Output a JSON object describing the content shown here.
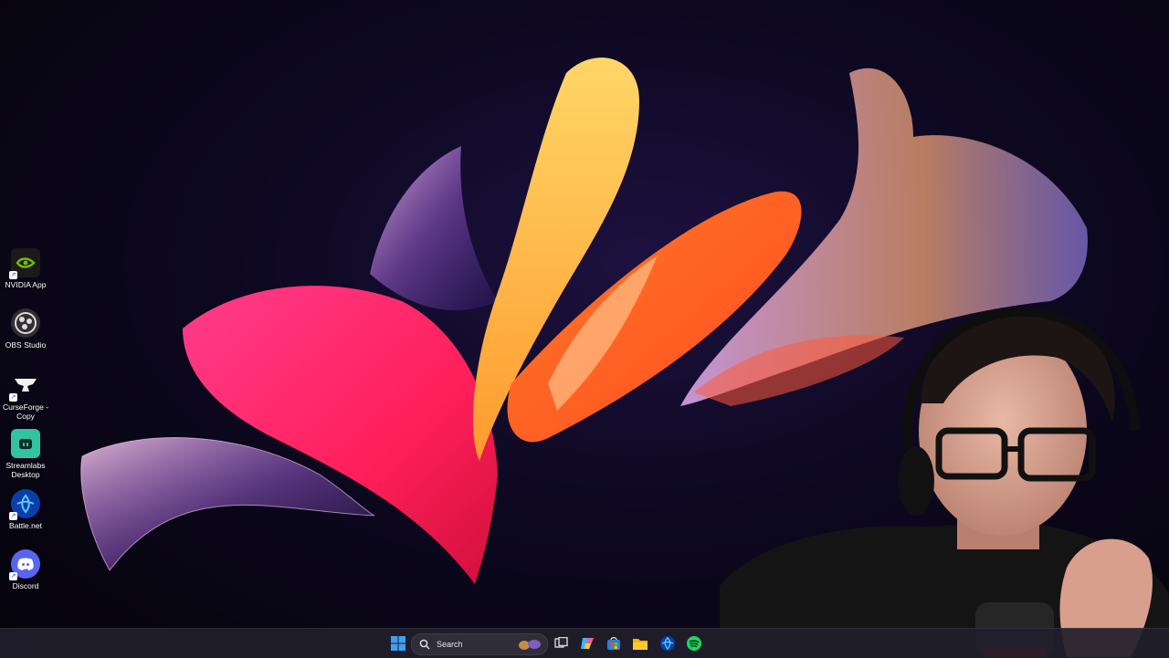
{
  "desktop": {
    "icons": [
      {
        "label": "NVIDIA App",
        "icon": "nvidia-icon",
        "color": "#76b900"
      },
      {
        "label": "OBS Studio",
        "icon": "obs-icon",
        "color": "#302e31"
      },
      {
        "label": "CurseForge - Copy",
        "icon": "curseforge-icon",
        "color": "#1b1b1b"
      },
      {
        "label": "Streamlabs Desktop",
        "icon": "streamlabs-icon",
        "color": "#31c3a2"
      },
      {
        "label": "Battle.net",
        "icon": "battlenet-icon",
        "color": "#148eff"
      },
      {
        "label": "Discord",
        "icon": "discord-icon",
        "color": "#5865f2"
      }
    ]
  },
  "taskbar": {
    "search_label": "Search",
    "apps": [
      {
        "name": "task-view-icon"
      },
      {
        "name": "copilot-icon"
      },
      {
        "name": "microsoft-store-icon"
      },
      {
        "name": "file-explorer-icon"
      },
      {
        "name": "battlenet-taskbar-icon"
      },
      {
        "name": "spotify-icon"
      }
    ]
  },
  "colors": {
    "accent_windows": "#3fa0f0",
    "taskbar_bg": "#221e2c",
    "wallpaper_pink": "#ff2d78",
    "wallpaper_orange": "#ff8a2a",
    "wallpaper_yellow": "#ffc53d"
  }
}
